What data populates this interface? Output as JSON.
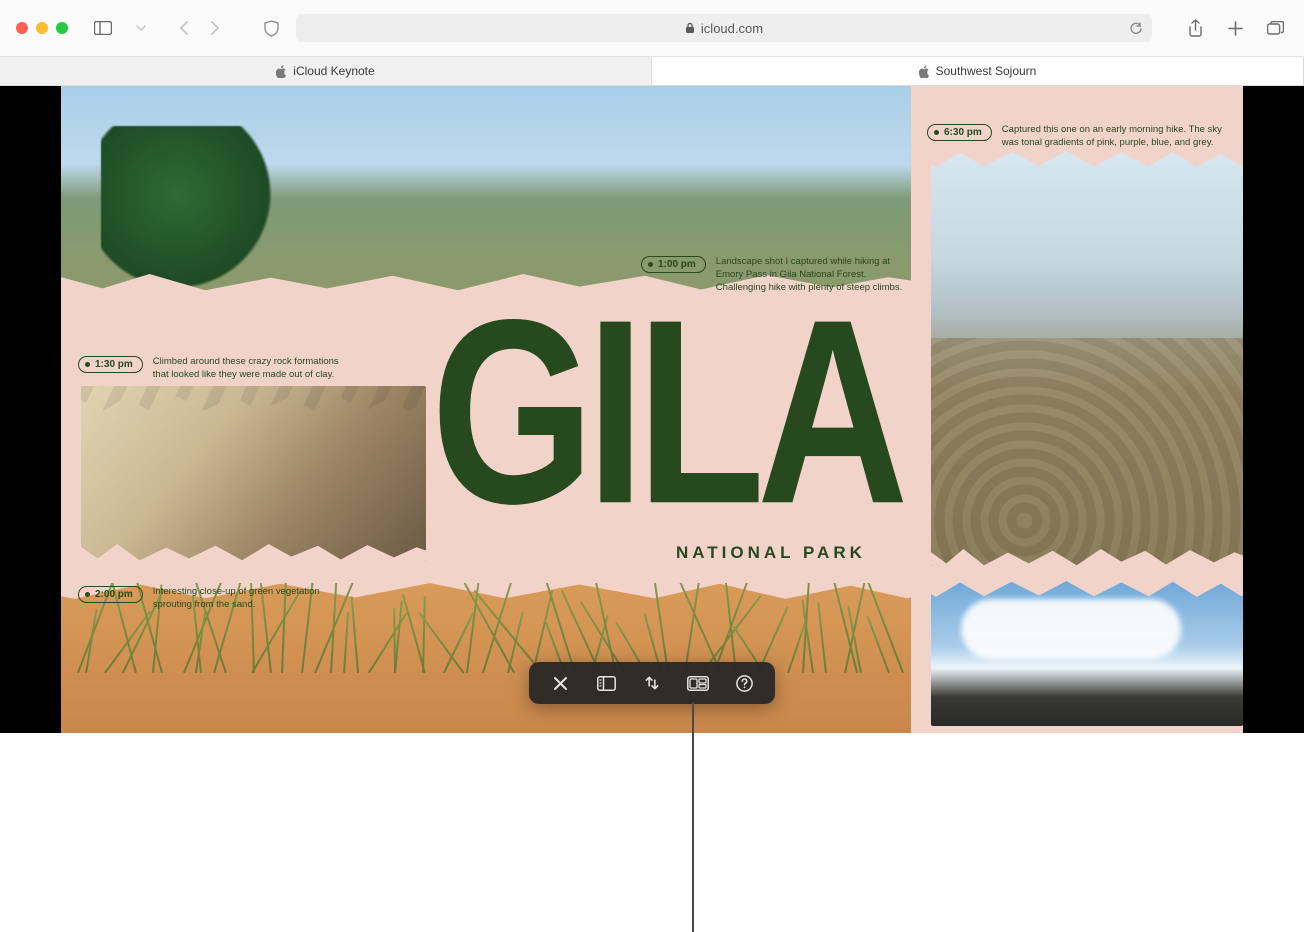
{
  "browser": {
    "url_display": "icloud.com",
    "tabs": [
      {
        "label": "iCloud Keynote",
        "active": false
      },
      {
        "label": "Southwest Sojourn",
        "active": true
      }
    ]
  },
  "slide": {
    "title": "GILA",
    "subtitle": "NATIONAL PARK",
    "notes": [
      {
        "time": "1:00 pm",
        "caption": "Landscape shot I captured while hiking at Emory Pass in Gila National Forest. Challenging hike with plenty of steep climbs."
      },
      {
        "time": "1:30 pm",
        "caption": "Climbed around these crazy rock formations that looked like they were made out of clay."
      },
      {
        "time": "2:00 pm",
        "caption": "Interesting close-up of green vegetation sprouting from the sand."
      },
      {
        "time": "6:30 pm",
        "caption": "Captured this one on an early morning hike. The sky was tonal gradients of pink, purple, blue, and grey."
      }
    ]
  },
  "icons": {
    "sidebar": "sidebar-icon",
    "back": "chevron-left-icon",
    "forward": "chevron-right-icon",
    "shield": "privacy-shield-icon",
    "lock": "lock-icon",
    "reload": "reload-icon",
    "share": "share-icon",
    "plus": "plus-icon",
    "tabs": "tab-overview-icon",
    "close": "close-icon",
    "navigator": "slide-navigator-icon",
    "fullscreen": "fullscreen-icon",
    "layouts": "keynote-live-icon",
    "help": "help-icon"
  }
}
